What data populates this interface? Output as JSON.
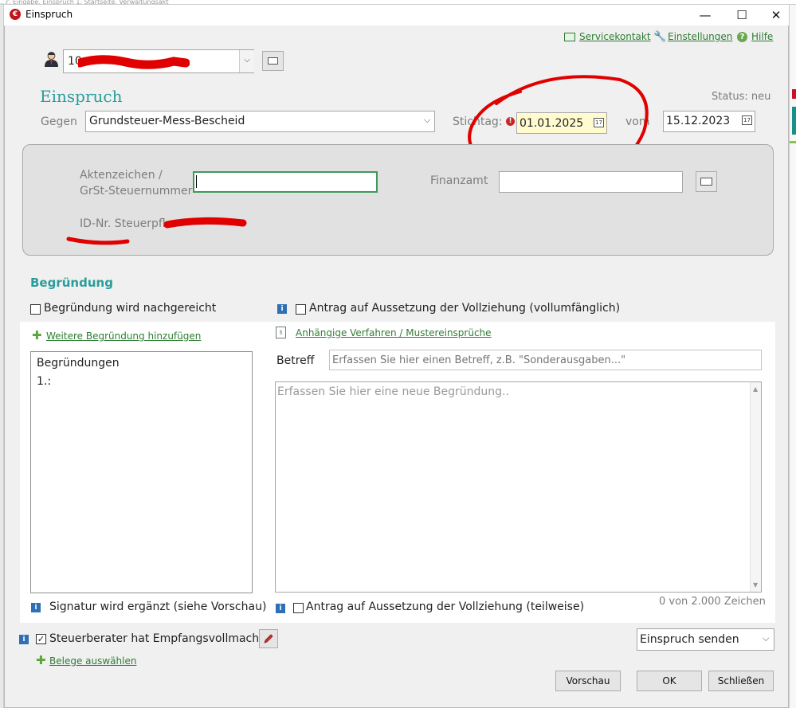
{
  "window": {
    "title": "Einspruch",
    "background_breadcrumb": "...r, Eingabe, Einspruch 1, Startseite, Verwaltungsakt",
    "controls": {
      "minimize": "—",
      "maximize": "☐",
      "close": "✕"
    }
  },
  "links": {
    "service": "Servicekontakt",
    "settings": "Einstellungen",
    "help": "Hilfe"
  },
  "client": {
    "value": "10"
  },
  "heading": "Einspruch",
  "status": "Status: neu",
  "gegen": {
    "label": "Gegen",
    "value": "Grundsteuer-Mess-Bescheid"
  },
  "stichtag": {
    "label": "Stichtag:",
    "value": "01.01.2025"
  },
  "von": {
    "label": "vom",
    "value": "15.12.2023"
  },
  "panel": {
    "aktenzeichen_label_1": "Aktenzeichen  /",
    "aktenzeichen_label_2": "GrSt-Steuernummer",
    "aktenzeichen_value": "",
    "finanzamt_label": "Finanzamt",
    "finanzamt_value": "",
    "idnr_label": "ID-Nr. Steuerpfl.:"
  },
  "begruendung": {
    "heading": "Begründung",
    "nachgereicht": "Begründung wird nachgereicht",
    "aussetzung_voll": "Antrag auf Aussetzung der Vollziehung (vollumfänglich)",
    "weitere_link": "Weitere Begründung hinzufügen",
    "anhaengige_link": "Anhängige Verfahren / Mustereinsprüche",
    "list_title": "Begründungen",
    "list_item": "1.:",
    "betreff_label": "Betreff",
    "betreff_placeholder": "Erfassen Sie hier einen Betreff, z.B. \"Sonderausgaben...\"",
    "text_placeholder": "Erfassen Sie hier eine neue Begründung..",
    "signatur": "Signatur wird ergänzt (siehe Vorschau)",
    "aussetzung_teil": "Antrag auf Aussetzung der Vollziehung (teilweise)",
    "counter": "0 von 2.000 Zeichen"
  },
  "footer": {
    "steuerberater": "Steuerberater hat Empfangsvollmacht",
    "belege_link": "Belege auswählen",
    "send_select": "Einspruch senden",
    "vorschau": "Vorschau",
    "ok": "OK",
    "schliessen": "Schließen"
  },
  "colors": {
    "accent_teal": "#2a9d9a",
    "link_green": "#2e7d32",
    "mandatory_yellow": "#fffbcf",
    "annotation_red": "#e00000"
  }
}
